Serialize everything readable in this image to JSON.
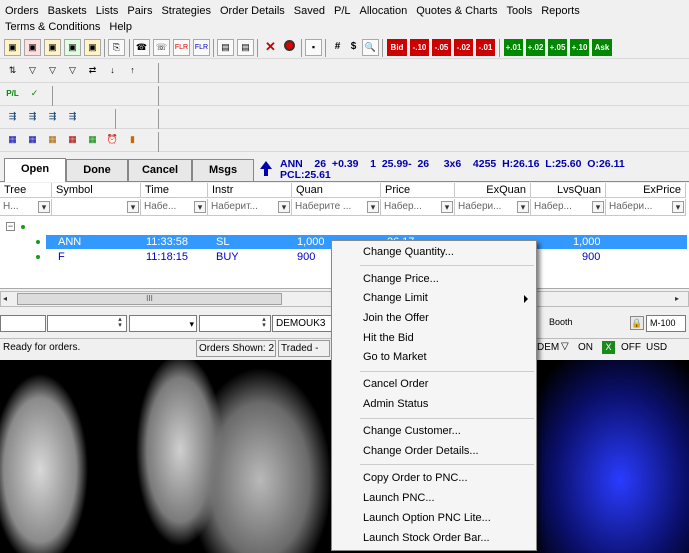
{
  "menu": {
    "row1": [
      "Orders",
      "Baskets",
      "Lists",
      "Pairs",
      "Strategies",
      "Order Details",
      "Saved",
      "P/L",
      "Allocation",
      "Quotes & Charts",
      "Tools",
      "Reports"
    ],
    "row2": [
      "Terms & Conditions",
      "Help"
    ]
  },
  "toolbar": {
    "text_buttons": [
      "#",
      "$",
      "Bid",
      "-.10",
      "-.05",
      "-.02",
      "-.01",
      "+.01",
      "+.02",
      "+.05",
      "+.10",
      "Ask"
    ],
    "pl_button": "P/L"
  },
  "tabs": [
    "Open",
    "Done",
    "Cancel",
    "Msgs"
  ],
  "ticker": {
    "line1": "ANN    26  +0.39    1  25.99-  26     3x6    4255  H:26.16  L:25.60  O:26.11",
    "line2": "PCL:25.61"
  },
  "columns": [
    "Tree",
    "Symbol",
    "Time",
    "Instr",
    "Quan",
    "Price",
    "ExQuan",
    "LvsQuan",
    "ExPrice"
  ],
  "filters": [
    "Н...",
    "",
    "Набе...",
    "Наберит...",
    "Наберите ...",
    "Набер...",
    "Набери...",
    "Набер...",
    "Набери..."
  ],
  "rows": [
    {
      "symbol": "ANN",
      "time": "11:33:58",
      "instr": "SL",
      "quan": "1,000",
      "price": "26.17",
      "lvsquan": "1,000"
    },
    {
      "symbol": "F",
      "time": "11:18:15",
      "instr": "BUY",
      "quan": "900",
      "price": "",
      "lvsquan": "900"
    }
  ],
  "scroll_label": "III",
  "bottom": {
    "account": "DEMOUK3",
    "booth": "Booth",
    "m_field": "M-100"
  },
  "status": {
    "ready": "Ready for orders.",
    "orders_shown": "Orders Shown: 2",
    "traded": "Traded -",
    "dem": "DEM",
    "on": "ON",
    "off": "OFF",
    "currency": "USD"
  },
  "context_menu": {
    "items": [
      {
        "label": "Change Quantity..."
      },
      {
        "label": "Change Price..."
      },
      {
        "label": "Change Limit",
        "submenu": true
      },
      {
        "label": "Join the Offer"
      },
      {
        "label": "Hit the Bid"
      },
      {
        "label": "Go to Market"
      },
      {
        "label": "Cancel Order"
      },
      {
        "label": "Admin Status"
      },
      {
        "label": "Change Customer..."
      },
      {
        "label": "Change Order Details..."
      },
      {
        "label": "Copy Order to PNC..."
      },
      {
        "label": "Launch PNC..."
      },
      {
        "label": "Launch Option PNC Lite..."
      },
      {
        "label": "Launch Stock Order Bar..."
      }
    ]
  },
  "colors": {
    "selection": "#3399ff",
    "row_text": "#0000cc",
    "ticker": "#0000b0",
    "bid_red": "#cc0000",
    "ask_green": "#008800"
  }
}
